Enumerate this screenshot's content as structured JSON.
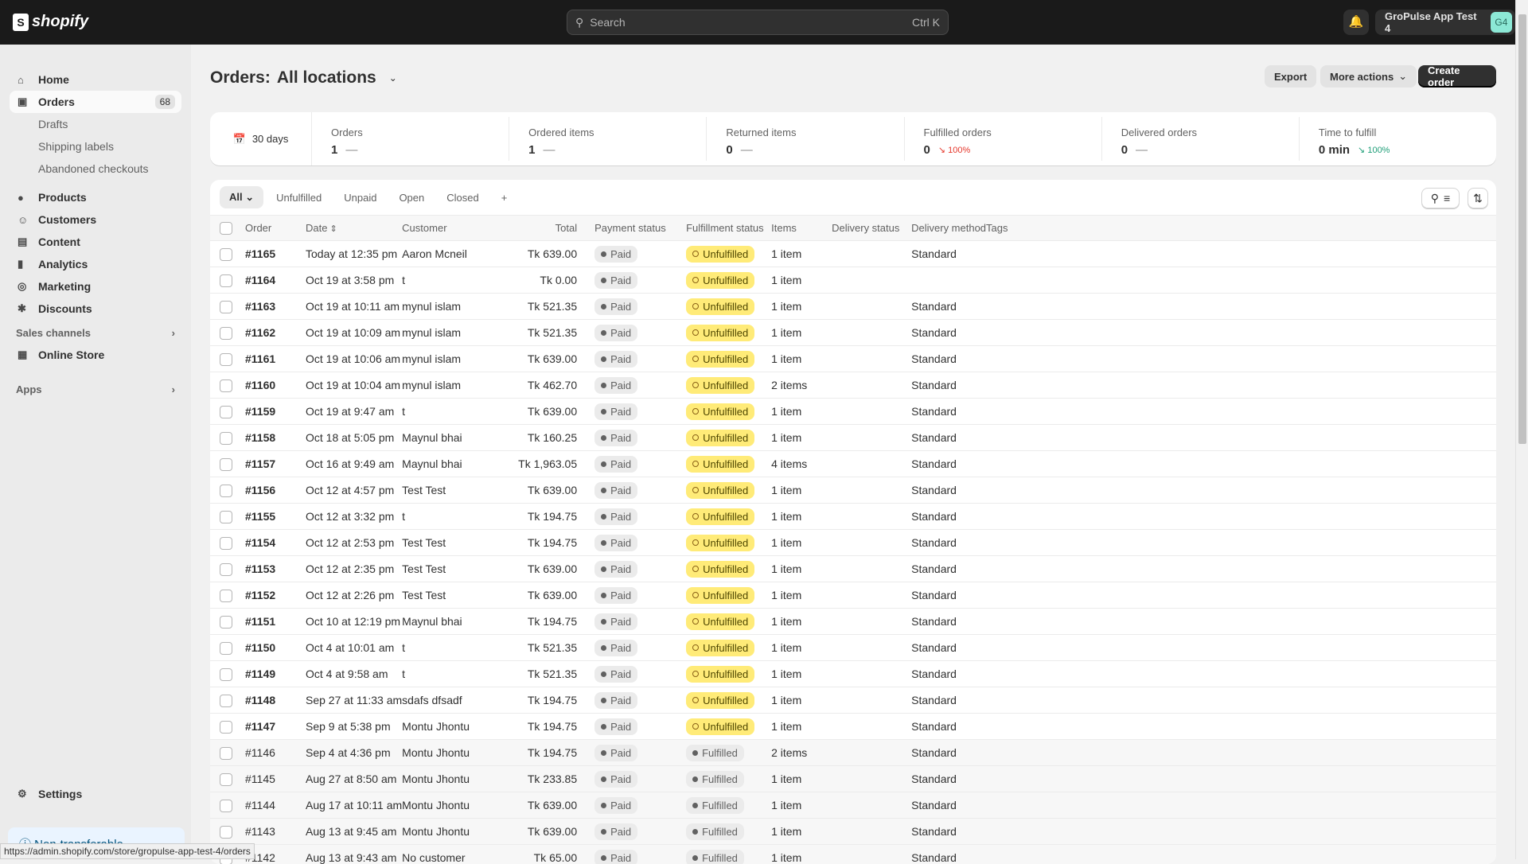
{
  "topbar": {
    "logo": "shopify",
    "search_placeholder": "Search",
    "search_shortcut": "Ctrl K",
    "store_name": "GroPulse App Test 4",
    "store_initials": "G4"
  },
  "sidebar": {
    "items": [
      {
        "label": "Home",
        "icon": "home-icon"
      },
      {
        "label": "Orders",
        "icon": "inbox-icon",
        "badge": "68"
      },
      {
        "label": "Drafts"
      },
      {
        "label": "Shipping labels"
      },
      {
        "label": "Abandoned checkouts"
      },
      {
        "label": "Products",
        "icon": "tag-icon"
      },
      {
        "label": "Customers",
        "icon": "person-icon"
      },
      {
        "label": "Content",
        "icon": "content-icon"
      },
      {
        "label": "Analytics",
        "icon": "bar-chart-icon"
      },
      {
        "label": "Marketing",
        "icon": "target-icon"
      },
      {
        "label": "Discounts",
        "icon": "discount-icon"
      }
    ],
    "sales_channels": "Sales channels",
    "online_store": "Online Store",
    "apps": "Apps",
    "settings": "Settings",
    "non_transferable": "Non-transferable"
  },
  "status_url": "https://admin.shopify.com/store/gropulse-app-test-4/orders",
  "page": {
    "title": "Orders:",
    "location": "All locations",
    "export": "Export",
    "more_actions": "More actions",
    "create_order": "Create order"
  },
  "stats": {
    "range": "30 days",
    "items": [
      {
        "label": "Orders",
        "value": "1",
        "change": "—"
      },
      {
        "label": "Ordered items",
        "value": "1",
        "change": "—"
      },
      {
        "label": "Returned items",
        "value": "0",
        "change": "—"
      },
      {
        "label": "Fulfilled orders",
        "value": "0",
        "change": "100%",
        "trend": "down"
      },
      {
        "label": "Delivered orders",
        "value": "0",
        "change": "—"
      },
      {
        "label": "Time to fulfill",
        "value": "0 min",
        "change": "100%",
        "trend": "down-good"
      }
    ]
  },
  "tabs": [
    "All",
    "Unfulfilled",
    "Unpaid",
    "Open",
    "Closed",
    "+"
  ],
  "columns": [
    "Order",
    "Date",
    "Customer",
    "Total",
    "Payment status",
    "Fulfillment status",
    "Items",
    "Delivery status",
    "Delivery method",
    "Tags"
  ],
  "orders": [
    [
      "#1165",
      "Today at 12:35 pm",
      "Aaron Mcneil",
      "Tk 639.00",
      "Paid",
      "Unfulfilled",
      "1 item",
      "Standard"
    ],
    [
      "#1164",
      "Oct 19 at 3:58 pm",
      "t",
      "Tk 0.00",
      "Paid",
      "Unfulfilled",
      "1 item",
      ""
    ],
    [
      "#1163",
      "Oct 19 at 10:11 am",
      "mynul islam",
      "Tk 521.35",
      "Paid",
      "Unfulfilled",
      "1 item",
      "Standard"
    ],
    [
      "#1162",
      "Oct 19 at 10:09 am",
      "mynul islam",
      "Tk 521.35",
      "Paid",
      "Unfulfilled",
      "1 item",
      "Standard"
    ],
    [
      "#1161",
      "Oct 19 at 10:06 am",
      "mynul islam",
      "Tk 639.00",
      "Paid",
      "Unfulfilled",
      "1 item",
      "Standard"
    ],
    [
      "#1160",
      "Oct 19 at 10:04 am",
      "mynul islam",
      "Tk 462.70",
      "Paid",
      "Unfulfilled",
      "2 items",
      "Standard"
    ],
    [
      "#1159",
      "Oct 19 at 9:47 am",
      "t",
      "Tk 639.00",
      "Paid",
      "Unfulfilled",
      "1 item",
      "Standard"
    ],
    [
      "#1158",
      "Oct 18 at 5:05 pm",
      "Maynul bhai",
      "Tk 160.25",
      "Paid",
      "Unfulfilled",
      "1 item",
      "Standard"
    ],
    [
      "#1157",
      "Oct 16 at 9:49 am",
      "Maynul bhai",
      "Tk 1,963.05",
      "Paid",
      "Unfulfilled",
      "4 items",
      "Standard"
    ],
    [
      "#1156",
      "Oct 12 at 4:57 pm",
      "Test Test",
      "Tk 639.00",
      "Paid",
      "Unfulfilled",
      "1 item",
      "Standard"
    ],
    [
      "#1155",
      "Oct 12 at 3:32 pm",
      "t",
      "Tk 194.75",
      "Paid",
      "Unfulfilled",
      "1 item",
      "Standard"
    ],
    [
      "#1154",
      "Oct 12 at 2:53 pm",
      "Test Test",
      "Tk 194.75",
      "Paid",
      "Unfulfilled",
      "1 item",
      "Standard"
    ],
    [
      "#1153",
      "Oct 12 at 2:35 pm",
      "Test Test",
      "Tk 639.00",
      "Paid",
      "Unfulfilled",
      "1 item",
      "Standard"
    ],
    [
      "#1152",
      "Oct 12 at 2:26 pm",
      "Test Test",
      "Tk 639.00",
      "Paid",
      "Unfulfilled",
      "1 item",
      "Standard"
    ],
    [
      "#1151",
      "Oct 10 at 12:19 pm",
      "Maynul bhai",
      "Tk 194.75",
      "Paid",
      "Unfulfilled",
      "1 item",
      "Standard"
    ],
    [
      "#1150",
      "Oct 4 at 10:01 am",
      "t",
      "Tk 521.35",
      "Paid",
      "Unfulfilled",
      "1 item",
      "Standard"
    ],
    [
      "#1149",
      "Oct 4 at 9:58 am",
      "t",
      "Tk 521.35",
      "Paid",
      "Unfulfilled",
      "1 item",
      "Standard"
    ],
    [
      "#1148",
      "Sep 27 at 11:33 am",
      "sdafs dfsadf",
      "Tk 194.75",
      "Paid",
      "Unfulfilled",
      "1 item",
      "Standard"
    ],
    [
      "#1147",
      "Sep 9 at 5:38 pm",
      "Montu Jhontu",
      "Tk 194.75",
      "Paid",
      "Unfulfilled",
      "1 item",
      "Standard"
    ],
    [
      "#1146",
      "Sep 4 at 4:36 pm",
      "Montu Jhontu",
      "Tk 194.75",
      "Paid",
      "Fulfilled",
      "2 items",
      "Standard"
    ],
    [
      "#1145",
      "Aug 27 at 8:50 am",
      "Montu Jhontu",
      "Tk 233.85",
      "Paid",
      "Fulfilled",
      "1 item",
      "Standard"
    ],
    [
      "#1144",
      "Aug 17 at 10:11 am",
      "Montu Jhontu",
      "Tk 639.00",
      "Paid",
      "Fulfilled",
      "1 item",
      "Standard"
    ],
    [
      "#1143",
      "Aug 13 at 9:45 am",
      "Montu Jhontu",
      "Tk 639.00",
      "Paid",
      "Fulfilled",
      "1 item",
      "Standard"
    ],
    [
      "#1142",
      "Aug 13 at 9:43 am",
      "No customer",
      "Tk 65.00",
      "Paid",
      "Fulfilled",
      "1 item",
      "Standard"
    ]
  ],
  "colors": {
    "unfulfilled": "#ffeb78",
    "topbar": "#1a1a1a",
    "decline": "#e5372b",
    "improve": "#1f9e78"
  }
}
